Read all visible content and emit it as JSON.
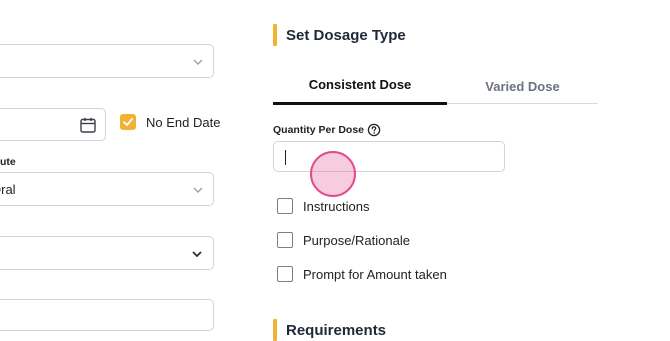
{
  "left": {
    "route_label": "ute",
    "route_value": "Oral",
    "no_end_date_label": "No End Date",
    "no_end_date_checked": true
  },
  "right": {
    "set_dosage_title": "Set Dosage Type",
    "tabs": [
      {
        "label": "Consistent Dose",
        "active": true
      },
      {
        "label": "Varied Dose",
        "active": false
      }
    ],
    "quantity_label": "Quantity Per Dose",
    "quantity_value": "",
    "options": [
      {
        "label": "Instructions",
        "checked": false
      },
      {
        "label": "Purpose/Rationale",
        "checked": false
      },
      {
        "label": "Prompt for Amount taken",
        "checked": false
      }
    ],
    "requirements_title": "Requirements"
  },
  "icons": {
    "chevron": "chevron-down-icon",
    "calendar": "calendar-icon",
    "help": "help-circle-icon",
    "check": "check-icon"
  },
  "colors": {
    "accent": "#f2b233",
    "tab_underline": "#111111",
    "touch_indicator": "#e24a8d"
  }
}
